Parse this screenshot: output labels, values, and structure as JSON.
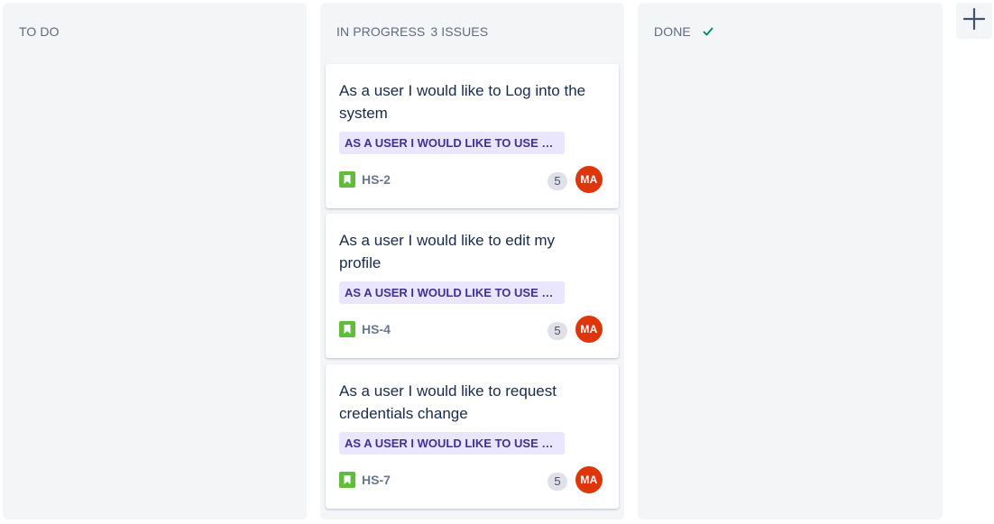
{
  "columns": {
    "todo": {
      "title": "TO DO"
    },
    "in_progress": {
      "title": "IN PROGRESS",
      "count": "3 ISSUES",
      "cards": [
        {
          "summary": "As a user I would like to Log into the system",
          "epic": "AS A USER I WOULD LIKE TO USE THE SYSTEM",
          "key": "HS-2",
          "estimate": "5",
          "assignee": "MA"
        },
        {
          "summary": "As a user I would like to edit my profile",
          "epic": "AS A USER I WOULD LIKE TO USE THE SYSTEM",
          "key": "HS-4",
          "estimate": "5",
          "assignee": "MA"
        },
        {
          "summary": "As a user I would like to request credentials change",
          "epic": "AS A USER I WOULD LIKE TO USE THE SYSTEM",
          "key": "HS-7",
          "estimate": "5",
          "assignee": "MA"
        }
      ]
    },
    "done": {
      "title": "DONE",
      "icon": "checkmark-icon"
    }
  },
  "add_column": {
    "icon": "plus-icon"
  },
  "colors": {
    "column_bg": "#f4f5f7",
    "epic_bg": "#eae6ff",
    "epic_text": "#403294",
    "story_icon": "#63ba3c",
    "avatar_bg": "#de350b",
    "done_check": "#00875a"
  }
}
